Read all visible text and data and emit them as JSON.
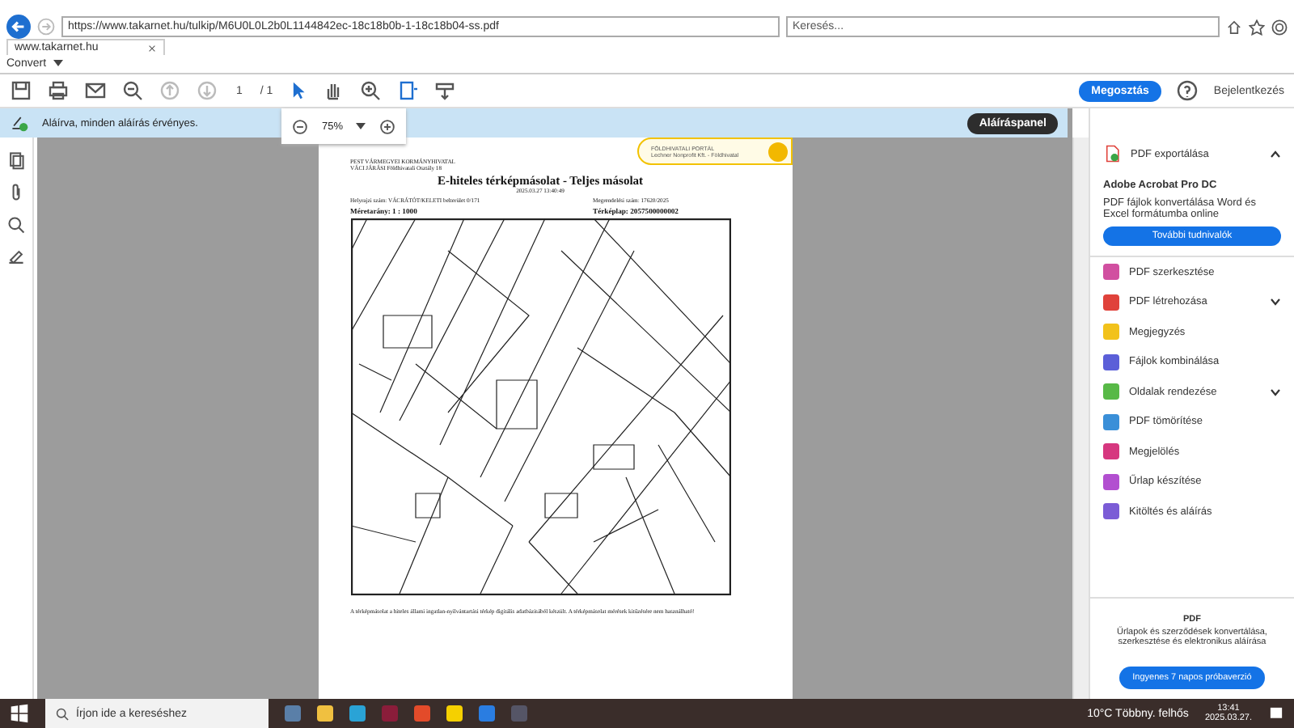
{
  "browser": {
    "address": "https://www.takarnet.hu/tulkip/M6U0L0L2b0L1144842ec-18c18b0b-1-18c18b04-ss.pdf",
    "search": {
      "placeholder": "Keresés..."
    },
    "tab": {
      "label": "www.takarnet.hu"
    },
    "favorites": [
      {
        "label": "Convert"
      }
    ]
  },
  "toolbar": {
    "page": "1",
    "page_total": "/ 1",
    "zoom": "75%",
    "share_button": "Megosztás",
    "login": "Bejelentkezés"
  },
  "signature_bar": {
    "message": "Aláírva, minden aláírás érvényes.",
    "panel_button": "Aláíráspanel"
  },
  "document": {
    "stamp": [
      "FÖLDHIVATALI PORTÁL",
      "Lechner Nonprofit Kft. - Földhivatal"
    ],
    "header": [
      "PEST VÁRMEGYEI KORMÁNYHIVATAL",
      "VÁCI JÁRÁSI Földhivatali Osztály 18"
    ],
    "title": "E-hiteles térképmásolat - Teljes másolat",
    "timestamp": "2025.03.27 13:40:49",
    "fields": [
      {
        "label": "Helyrajzi szám:",
        "value": "VÁCRÁTÓT/KELETI belterület 0/171"
      },
      {
        "label": "Megrendelési szám:",
        "value": "17620/2025"
      },
      {
        "label": "Méretarány:",
        "value": "1 : 1000"
      },
      {
        "label": "Térképlap:",
        "value": "2057500000002"
      }
    ],
    "footnote": "A térképmásolat a hiteles állami ingatlan-nyilvántartási térkép digitális adatbázisából készült. A térképmásolat mérések kitűzésére nem használható!"
  },
  "side_panel": {
    "export": {
      "label": "PDF exportálása",
      "expanded": true
    },
    "promo": {
      "title": "Adobe Acrobat Pro DC",
      "text": "PDF fájlok konvertálása Word és Excel formátumba online",
      "button": "További tudnivalók"
    },
    "tools": [
      {
        "label": "PDF szerkesztése",
        "color": "#d14fa0",
        "expandable": false
      },
      {
        "label": "PDF létrehozása",
        "color": "#e0423b",
        "expandable": true
      },
      {
        "label": "Megjegyzés",
        "color": "#f2c21b",
        "expandable": false
      },
      {
        "label": "Fájlok kombinálása",
        "color": "#5b5fd8",
        "expandable": false
      },
      {
        "label": "Oldalak rendezése",
        "color": "#58b947",
        "expandable": true
      },
      {
        "label": "PDF tömörítése",
        "color": "#3a8fd8",
        "expandable": false
      },
      {
        "label": "Megjelölés",
        "color": "#d6377f",
        "expandable": false
      },
      {
        "label": "Űrlap készítése",
        "color": "#b24fd0",
        "expandable": false
      },
      {
        "label": "Kitöltés és aláírás",
        "color": "#7b5cd6",
        "expandable": false
      }
    ],
    "footer": {
      "title": "PDF",
      "text": "Űrlapok és szerződések konvertálása, szerkesztése és elektronikus aláírása",
      "button": "Ingyenes 7 napos próbaverzió"
    }
  },
  "taskbar": {
    "search": {
      "placeholder": "Írjon ide a kereséshez"
    },
    "weather": "10°C Többny. felhős",
    "time": "13:41",
    "date": "2025.03.27."
  }
}
